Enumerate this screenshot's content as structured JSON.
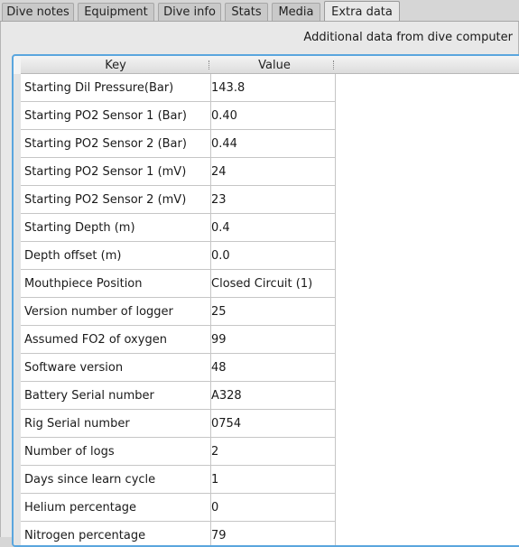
{
  "tabs": [
    {
      "label": "Dive notes",
      "active": false
    },
    {
      "label": "Equipment",
      "active": false
    },
    {
      "label": "Dive info",
      "active": false
    },
    {
      "label": "Stats",
      "active": false
    },
    {
      "label": "Media",
      "active": false
    },
    {
      "label": "Extra data",
      "active": true
    }
  ],
  "caption": "Additional data from dive computer",
  "table": {
    "columns": [
      "Key",
      "Value"
    ],
    "rows": [
      {
        "key": "Starting Dil Pressure(Bar)",
        "value": "143.8"
      },
      {
        "key": "Starting PO2 Sensor 1 (Bar)",
        "value": "0.40"
      },
      {
        "key": "Starting PO2 Sensor 2 (Bar)",
        "value": "0.44"
      },
      {
        "key": "Starting PO2 Sensor 1 (mV)",
        "value": "24"
      },
      {
        "key": "Starting PO2 Sensor 2 (mV)",
        "value": "23"
      },
      {
        "key": "Starting Depth (m)",
        "value": "0.4"
      },
      {
        "key": "Depth offset (m)",
        "value": "0.0"
      },
      {
        "key": "Mouthpiece Position",
        "value": "Closed Circuit (1)"
      },
      {
        "key": "Version number of logger",
        "value": "25"
      },
      {
        "key": "Assumed FO2 of oxygen",
        "value": "99"
      },
      {
        "key": "Software version",
        "value": "48"
      },
      {
        "key": "Battery Serial number",
        "value": "A328"
      },
      {
        "key": "Rig Serial number",
        "value": "0754"
      },
      {
        "key": "Number of logs",
        "value": "2"
      },
      {
        "key": "Days since learn cycle",
        "value": "1"
      },
      {
        "key": "Helium percentage",
        "value": "0"
      },
      {
        "key": "Nitrogen percentage",
        "value": "79"
      }
    ]
  }
}
